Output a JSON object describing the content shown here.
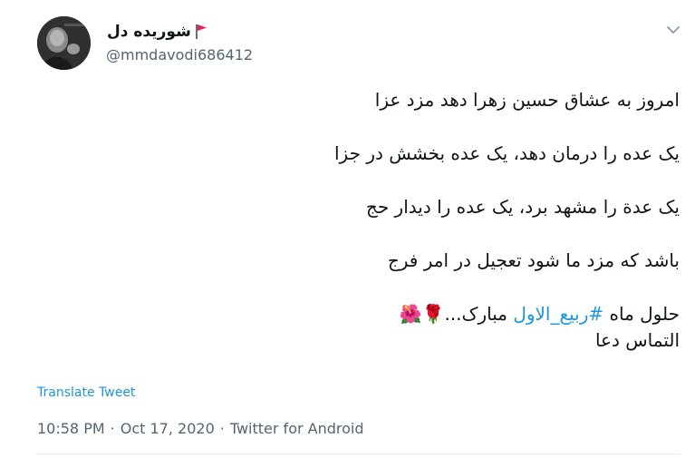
{
  "author": {
    "display_name": "شوریده دل",
    "handle": "@mmdavodi686412",
    "flag_icon": "red-flag-icon",
    "flag_color": "#e0245e"
  },
  "tweet": {
    "line1": "امروز به عشاق حسین زهرا دهد مزد عزا",
    "line2": "یک عده را درمان دهد، یک عده بخشش در جزا",
    "line3": "یک عدة را مشهد برد، یک عده را دیدار حج",
    "line4": "باشد که مزد ما شود تعجیل در امر فرج",
    "line5_prefix": "حلول ماه ",
    "line5_hashtag": "#ربیع_الاول",
    "line5_suffix": " مبارک...",
    "line5_emoji": "🌹🌺",
    "line6": "التماس دعا"
  },
  "translate_label": "Translate Tweet",
  "meta": {
    "time": "10:58 PM",
    "sep1": "·",
    "date": "Oct 17, 2020",
    "sep2": "·",
    "source": "Twitter for Android"
  },
  "colors": {
    "link": "#1b95e0",
    "muted": "#536471",
    "text": "#0f1419"
  }
}
